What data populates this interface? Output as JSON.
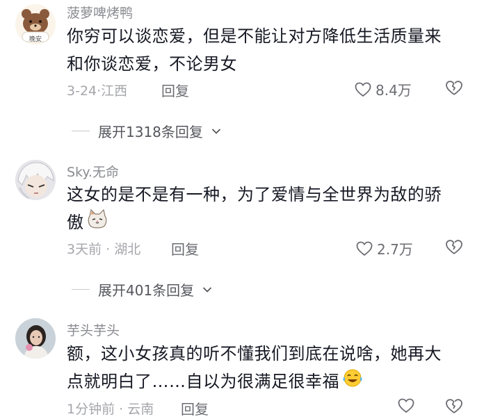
{
  "comments": [
    {
      "username": "菠萝啤烤鸭",
      "avatar_badge": "晚安",
      "text_lines": [
        "你穷可以谈恋爱，但是不能让对方降低生活质量来",
        "和你谈恋爱，不论男女"
      ],
      "date": "3-24",
      "location": "江西",
      "reply_label": "回复",
      "likes": "8.4万",
      "expand_label": "展开1318条回复"
    },
    {
      "username": "Sky.无命",
      "text_lines": [
        "这女的是不是有一种，为了爱情与全世界为敌的骄",
        "傲"
      ],
      "date": "3天前",
      "location": "湖北",
      "reply_label": "回复",
      "likes": "2.7万",
      "expand_label": "展开401条回复",
      "emoji_icon": "cat-face-icon"
    },
    {
      "username": "芋头芋头",
      "text_lines": [
        "额，这小女孩真的听不懂我们到底在说啥，她再大",
        "点就明白了……自以为很满足很幸福"
      ],
      "date": "1分钟前",
      "location": "云南",
      "reply_label": "回复",
      "likes": "",
      "emoji_icon": "laughing-tears-icon"
    }
  ],
  "colors": {
    "text": "#161823",
    "muted": "#a5a6ab",
    "username": "#8a8b91"
  }
}
